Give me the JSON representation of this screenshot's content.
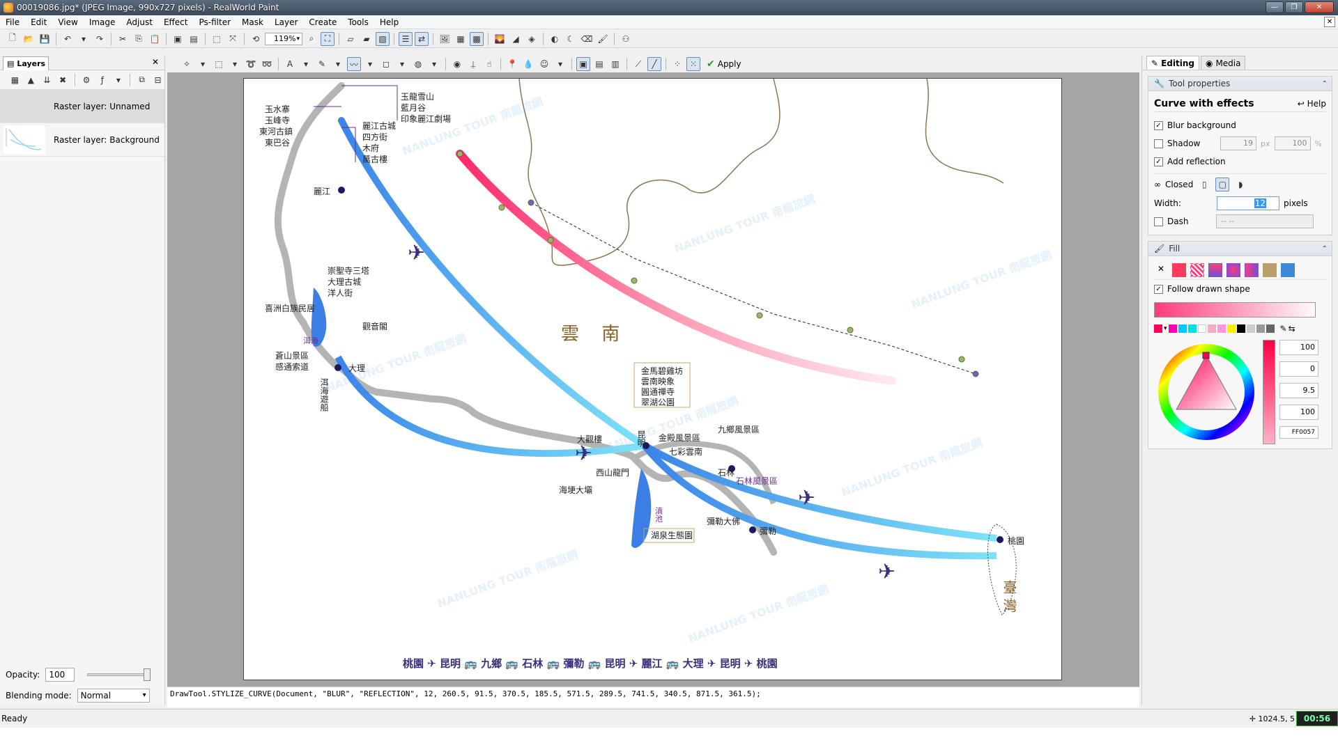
{
  "window": {
    "title": "00019086.jpg* (JPEG Image, 990x727 pixels) - RealWorld Paint",
    "controls": [
      "—",
      "❐",
      "✕"
    ]
  },
  "menu": [
    "File",
    "Edit",
    "View",
    "Image",
    "Adjust",
    "Effect",
    "Ps-filter",
    "Mask",
    "Layer",
    "Create",
    "Tools",
    "Help"
  ],
  "toolbar": {
    "zoom": "119%",
    "apply_label": "Apply"
  },
  "layers_panel": {
    "tab_label": "Layers",
    "layers": [
      {
        "name": "Raster layer: Unnamed",
        "selected": true
      },
      {
        "name": "Raster layer: Background",
        "selected": false
      }
    ],
    "opacity_label": "Opacity:",
    "opacity_value": "100",
    "blending_label": "Blending mode:",
    "blending_value": "Normal"
  },
  "canvas": {
    "region_label": "雲 南",
    "cities": {
      "lijiang": "麗江",
      "dali": "大理",
      "kunming": "昆明",
      "taoyuan": "桃園",
      "shilin": "石林",
      "mile": "彌勒",
      "taiwan": "臺 灣",
      "erhai": "洱海",
      "dianchi": "滇池"
    },
    "lijiang_left": [
      "玉水寨",
      "玉峰寺",
      "東河古鎮",
      "東巴谷"
    ],
    "lijiang_right": [
      "麗江古城",
      "四方街",
      "木府",
      "萬古樓"
    ],
    "lijiang_top": [
      "玉龍雪山",
      "藍月谷",
      "印象麗江劇場"
    ],
    "dali_top": [
      "崇聖寺三塔",
      "大理古城",
      "洋人街"
    ],
    "dali_labels": {
      "xizhou": "喜洲白族民居",
      "guanyin": "觀音閣",
      "cangshan": [
        "蒼山景區",
        "感通索道"
      ],
      "boat": "洱海遊船"
    },
    "kunming_box": [
      "金馬碧雞坊",
      "雲南映象",
      "圓通禪寺",
      "翠湖公園"
    ],
    "kunming_labels": {
      "daguanlou": "大觀樓",
      "xishan": "西山龍門",
      "haigeng": "海埂大壩",
      "jindian": "金殿風景區",
      "qicai": "七彩雲南",
      "jiuxiang": "九鄉風景區",
      "shilin_scenic": "石林風景區",
      "mile_buddha": "彌勒大佛",
      "hot_spring": "湖泉生態園"
    },
    "route": "桃園 ✈ 昆明 🚌 九鄉 🚌 石林 🚌 彌勒 🚌 昆明 ✈ 麗江 🚌 大理 ✈ 昆明 ✈ 桃園",
    "watermark": "NANLUNG TOUR 南龍旅網"
  },
  "command_line": "DrawTool.STYLIZE_CURVE(Document, \"BLUR\", \"REFLECTION\", 12, 260.5, 91.5, 370.5, 185.5, 571.5, 289.5, 741.5, 340.5, 871.5, 361.5);",
  "right_panel": {
    "tabs": [
      "Editing",
      "Media"
    ],
    "tool_properties_label": "Tool properties",
    "tool_name": "Curve with effects",
    "help_label": "Help",
    "blur_label": "Blur background",
    "blur_checked": true,
    "shadow_label": "Shadow",
    "shadow_checked": false,
    "shadow_px": "19",
    "shadow_px_unit": "px",
    "shadow_pct": "100",
    "shadow_pct_unit": "%",
    "reflection_label": "Add reflection",
    "reflection_checked": true,
    "closed_label": "Closed",
    "width_label": "Width:",
    "width_value": "12",
    "width_unit": "pixels",
    "dash_label": "Dash",
    "dash_value": "-- --",
    "fill_label": "Fill",
    "follow_label": "Follow drawn shape",
    "color_values": [
      "100",
      "0",
      "9.5",
      "100"
    ],
    "hex": "FF0057"
  },
  "status": {
    "text": "Ready",
    "coords": "1024.5, 5",
    "clock": "00:56"
  }
}
